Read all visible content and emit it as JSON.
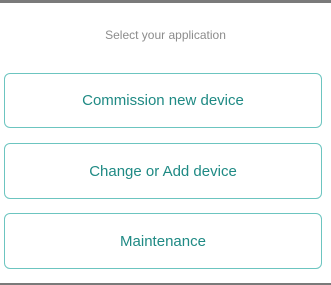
{
  "prompt": {
    "label": "Select your application"
  },
  "options": [
    {
      "label": "Commission new device"
    },
    {
      "label": "Change or Add device"
    },
    {
      "label": "Maintenance"
    }
  ],
  "colors": {
    "accent_border": "#6cc5c0",
    "accent_text": "#1f8a84",
    "prompt_text": "#8c8c8c",
    "rule": "#7a7a7a",
    "background": "#ffffff"
  }
}
